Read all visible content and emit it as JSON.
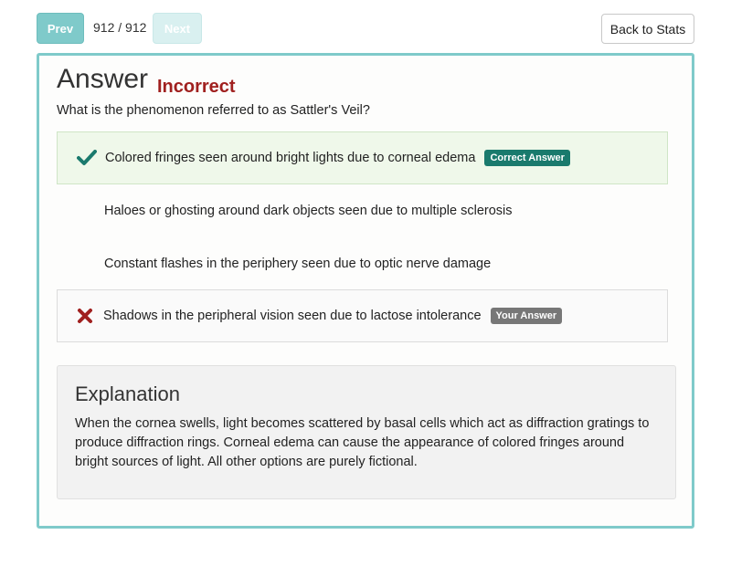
{
  "nav": {
    "prev_label": "Prev",
    "counter": "912 / 912",
    "next_label": "Next",
    "back_label": "Back to Stats"
  },
  "answer": {
    "title": "Answer",
    "result": "Incorrect",
    "question": "What is the phenomenon referred to as Sattler's Veil?"
  },
  "options": [
    {
      "text": "Colored fringes seen around bright lights due to corneal edema",
      "status": "correct",
      "badge": "Correct Answer",
      "icon": "checkmark-icon"
    },
    {
      "text": "Haloes or ghosting around dark objects seen due to multiple sclerosis",
      "status": "neutral"
    },
    {
      "text": "Constant flashes in the periphery seen due to optic nerve damage",
      "status": "neutral"
    },
    {
      "text": "Shadows in the peripheral vision seen due to lactose intolerance",
      "status": "wrong",
      "badge": "Your Answer",
      "icon": "x-mark-icon"
    }
  ],
  "explanation": {
    "title": "Explanation",
    "text": "When the cornea swells, light becomes scattered by basal cells which act as diffraction gratings to produce diffraction rings. Corneal edema can cause the appearance of colored fringes around bright sources of light. All other options are purely fictional."
  },
  "colors": {
    "accent": "#7fcaca",
    "incorrect": "#a0201f",
    "correct_badge": "#1a7a6d",
    "your_badge": "#777777",
    "check": "#1a7a6d",
    "cross": "#a0201f"
  }
}
